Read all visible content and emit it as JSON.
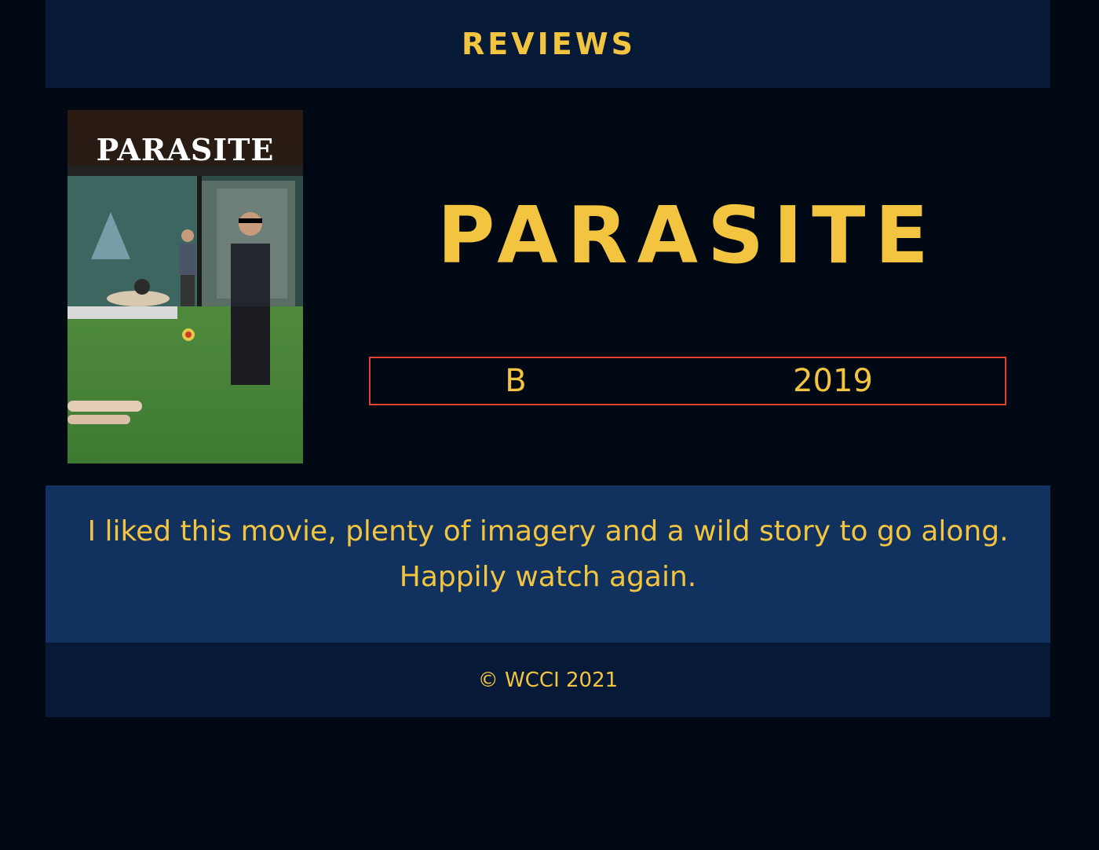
{
  "header": {
    "nav_label": "REVIEWS"
  },
  "movie": {
    "poster_title": "PARASITE",
    "title": "PARASITE",
    "grade": "B",
    "year": "2019"
  },
  "review": {
    "text": "I liked this movie, plenty of imagery and a wild story to go along. Happily watch again."
  },
  "footer": {
    "copyright": "© WCCI 2021"
  },
  "colors": {
    "page_bg": "#000814",
    "header_bg": "#061a38",
    "review_bg": "#11315f",
    "accent": "#f3c43f",
    "box_border": "#e0402e"
  }
}
